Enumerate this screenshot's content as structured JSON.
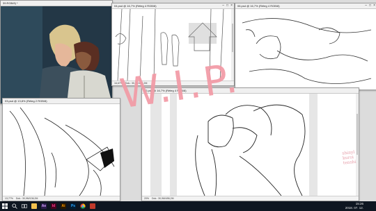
{
  "desktop": {
    "background_color": "#dcdcdc"
  },
  "windows": {
    "w1": {
      "title": "39.RGB/8) *",
      "status": ""
    },
    "w2": {
      "title": "04.psd @ 16,7% (Réteg 4 RGB/8)",
      "zoom": "16,67%",
      "status": "Dok.: 30,9M/156,2M"
    },
    "w3": {
      "title": "06.psd @ 16,7% (Réteg 4 RGB/8)",
      "status": ""
    },
    "w4": {
      "title": "03.psd @ 13,8% (Réteg 2 RGB/8)",
      "zoom": "13,77%",
      "status": "Dok.: 30,9M/136,2M"
    },
    "w5": {
      "title": "02.psd @ 16,7% (Réteg 4 RGB/8)",
      "zoom": "20%",
      "status": "Dok.: 30,9M/496,2M"
    }
  },
  "watermark": {
    "text": "W.I.P.",
    "color": "#f29aa5"
  },
  "signature": {
    "text": "shinyl kuroi tenshi",
    "color": "#e59aa6"
  },
  "taskbar": {
    "apps": [
      {
        "icon": "windows-start-icon",
        "label": "",
        "color": "#ffffff"
      },
      {
        "icon": "search-icon",
        "label": "",
        "color": "#ffffff"
      },
      {
        "icon": "task-view-icon",
        "label": "",
        "color": "#ffffff"
      },
      {
        "icon": "file-explorer-icon",
        "label": "",
        "color": "#f2c14e"
      },
      {
        "icon": "after-effects-icon",
        "label": "Ae",
        "color": "#2b1a4a"
      },
      {
        "icon": "indesign-icon",
        "label": "Id",
        "color": "#49021f"
      },
      {
        "icon": "illustrator-icon",
        "label": "Ai",
        "color": "#2a1900"
      },
      {
        "icon": "photoshop-icon",
        "label": "Ps",
        "color": "#001e36"
      },
      {
        "icon": "chrome-icon",
        "label": "",
        "color": "#4285f4"
      },
      {
        "icon": "app-icon",
        "label": "",
        "color": "#c0392b"
      }
    ],
    "time": "15:26",
    "date": "2018. 07. 12."
  }
}
